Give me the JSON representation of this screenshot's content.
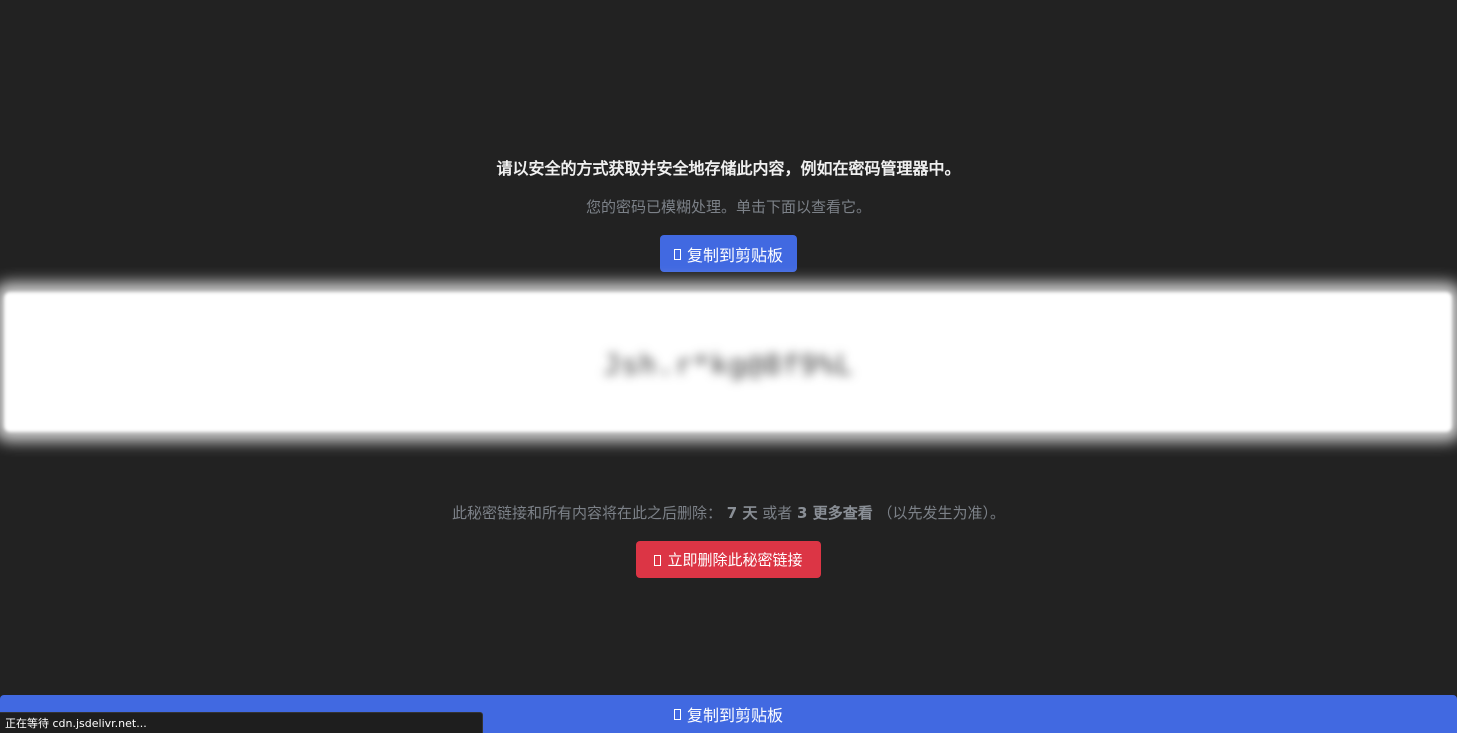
{
  "headline": "请以安全的方式获取并安全地存储此内容，例如在密码管理器中。",
  "subtitle": "您的密码已模糊处理。单击下面以查看它。",
  "copy_button": {
    "label": "复制到剪贴板",
    "icon": "clipboard-icon"
  },
  "secret": {
    "value": "Jsh.r*kg@8f9%L"
  },
  "expiry": {
    "prefix": "此秘密链接和所有内容将在此之后删除：",
    "days": "7 天",
    "or": "或者",
    "views": "3 更多查看",
    "suffix": "（以先发生为准）。"
  },
  "delete_button": {
    "label": "立即删除此秘密链接",
    "icon": "trash-icon"
  },
  "bottom_bar": {
    "label": "复制到剪贴板",
    "icon": "clipboard-icon"
  },
  "status": {
    "text": "正在等待 cdn.jsdelivr.net..."
  },
  "colors": {
    "background": "#222222",
    "primary": "#4169e1",
    "danger": "#dc3545",
    "muted_text": "#7c8188"
  }
}
